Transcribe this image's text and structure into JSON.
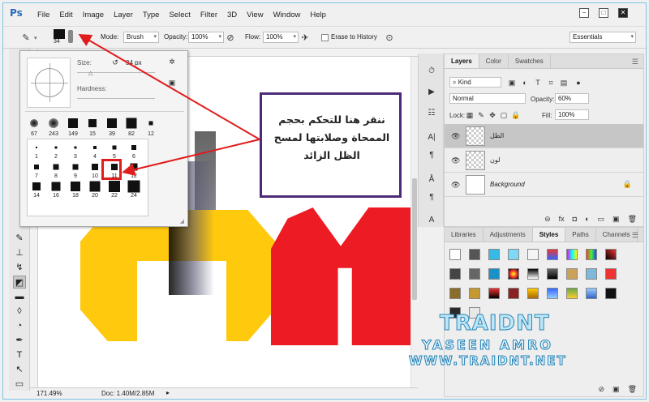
{
  "app": {
    "logo": "Ps",
    "menu": [
      "File",
      "Edit",
      "Image",
      "Layer",
      "Type",
      "Select",
      "Filter",
      "3D",
      "View",
      "Window",
      "Help"
    ],
    "window_controls": [
      "−",
      "□",
      "✕"
    ]
  },
  "options": {
    "brush_size": "34",
    "mode_label": "Mode:",
    "mode_value": "Brush",
    "opacity_label": "Opacity:",
    "opacity_value": "100%",
    "flow_label": "Flow:",
    "flow_value": "100%",
    "erase_history_label": "Erase to History",
    "workspace": "Essentials"
  },
  "brush_popup": {
    "size_label": "Size:",
    "size_value": "34 px",
    "hardness_label": "Hardness:",
    "presets": [
      "67",
      "243",
      "149",
      "15",
      "39",
      "82",
      "12"
    ],
    "grid": [
      "1",
      "2",
      "3",
      "4",
      "5",
      "6",
      "7",
      "8",
      "9",
      "10",
      "11",
      "12",
      "14",
      "16",
      "18",
      "20",
      "22",
      "24"
    ]
  },
  "callout": {
    "text": "ننقر هنا للتحكم بحجم الممحاة وصلابتها لمسح الظل الزائد"
  },
  "status": {
    "zoom": "171.49%",
    "doc": "Doc: 1.40M/2.85M"
  },
  "layers_panel": {
    "tabs": [
      "Layers",
      "Color",
      "Swatches"
    ],
    "kind": "Kind",
    "blend_mode": "Normal",
    "opacity_label": "Opacity:",
    "opacity_value": "60%",
    "lock_label": "Lock:",
    "fill_label": "Fill:",
    "fill_value": "100%",
    "layers": [
      {
        "name": "الظل",
        "selected": true
      },
      {
        "name": "لون",
        "selected": false
      },
      {
        "name": "Background",
        "selected": false
      }
    ],
    "footer": [
      "⊖",
      "fx",
      "◘",
      "◐",
      "▭",
      "▣",
      "🗑"
    ]
  },
  "styles_panel": {
    "tabs": [
      "Libraries",
      "Adjustments",
      "Styles",
      "Paths",
      "Channels"
    ],
    "active": "Styles"
  },
  "watermark": {
    "title": "TRAIDNT",
    "name": "YASEEN AMRO",
    "site": "WWW.TRAIDNT.NET"
  },
  "colors": {
    "yellow": "#ffc90e",
    "red": "#ed1c24",
    "callout_border": "#4b2a78",
    "highlight": "#e01d1d"
  }
}
